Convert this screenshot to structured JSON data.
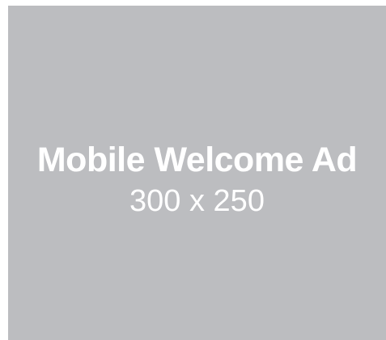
{
  "ad": {
    "title": "Mobile Welcome Ad",
    "size_text": "300 x 250",
    "background_color": "#bcbdc0",
    "text_color": "#ffffff"
  }
}
